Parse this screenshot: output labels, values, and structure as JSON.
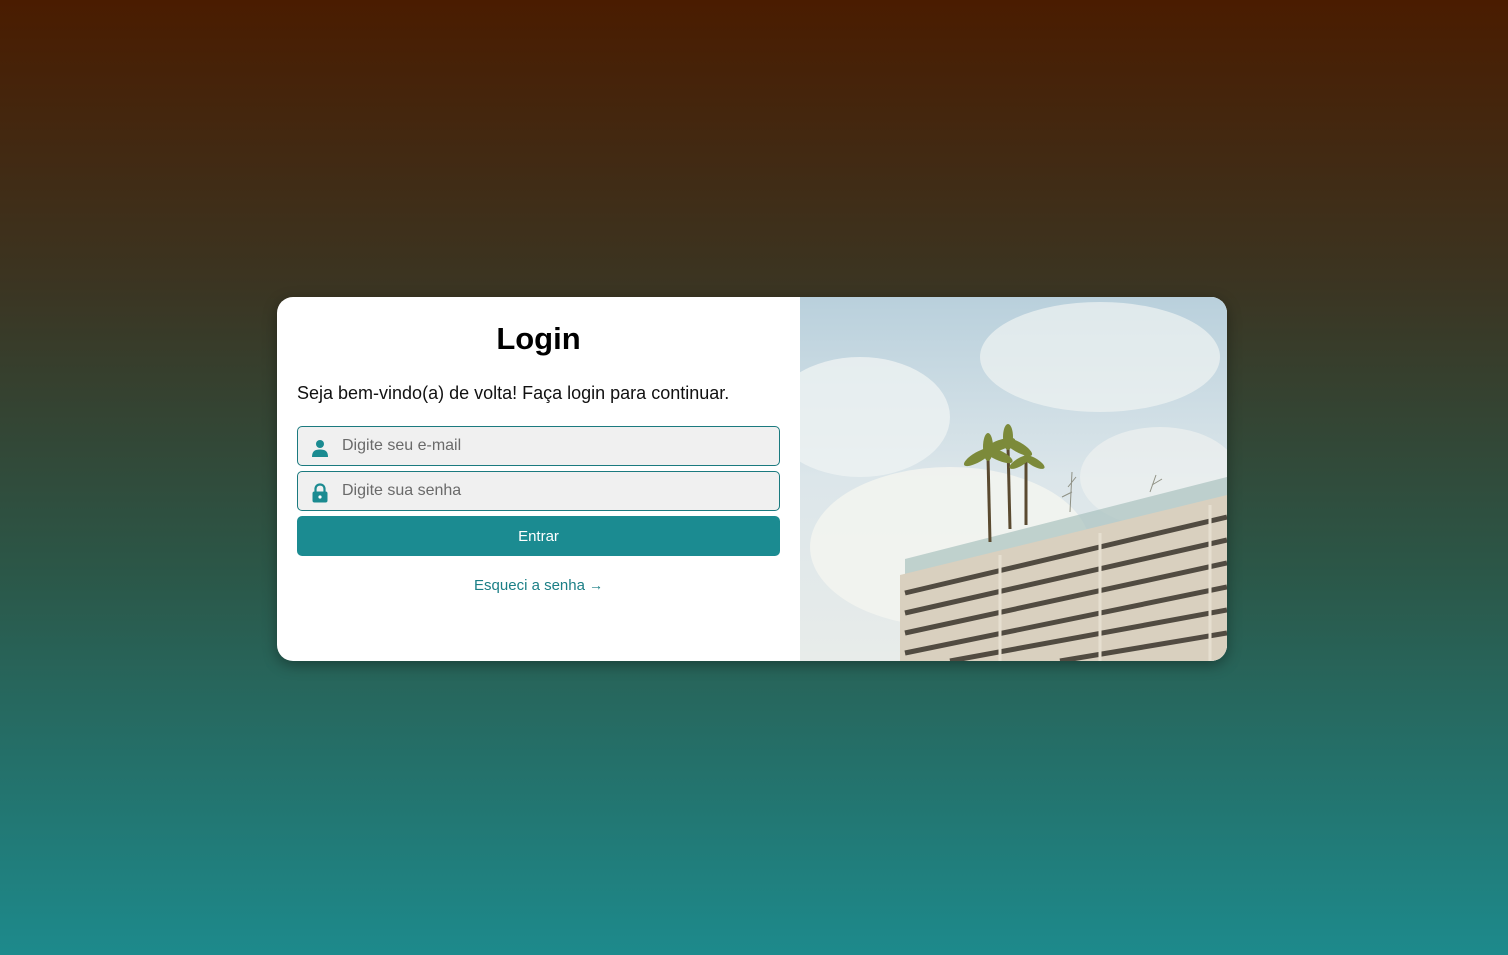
{
  "login": {
    "title": "Login",
    "subtitle": "Seja bem-vindo(a) de volta! Faça login para continuar.",
    "email_placeholder": "Digite seu e-mail",
    "password_placeholder": "Digite sua senha",
    "submit_label": "Entrar",
    "forgot_label": "Esqueci a senha",
    "forgot_arrow": "→"
  },
  "icons": {
    "email": "user-icon",
    "password": "lock-icon",
    "forgot": "arrow-right-icon"
  },
  "colors": {
    "accent": "#1b8b91",
    "border": "#1b7a7f",
    "link": "#1b7f86",
    "input_bg": "#f0f0f0"
  },
  "image": {
    "alt": "building-with-palm-trees"
  }
}
